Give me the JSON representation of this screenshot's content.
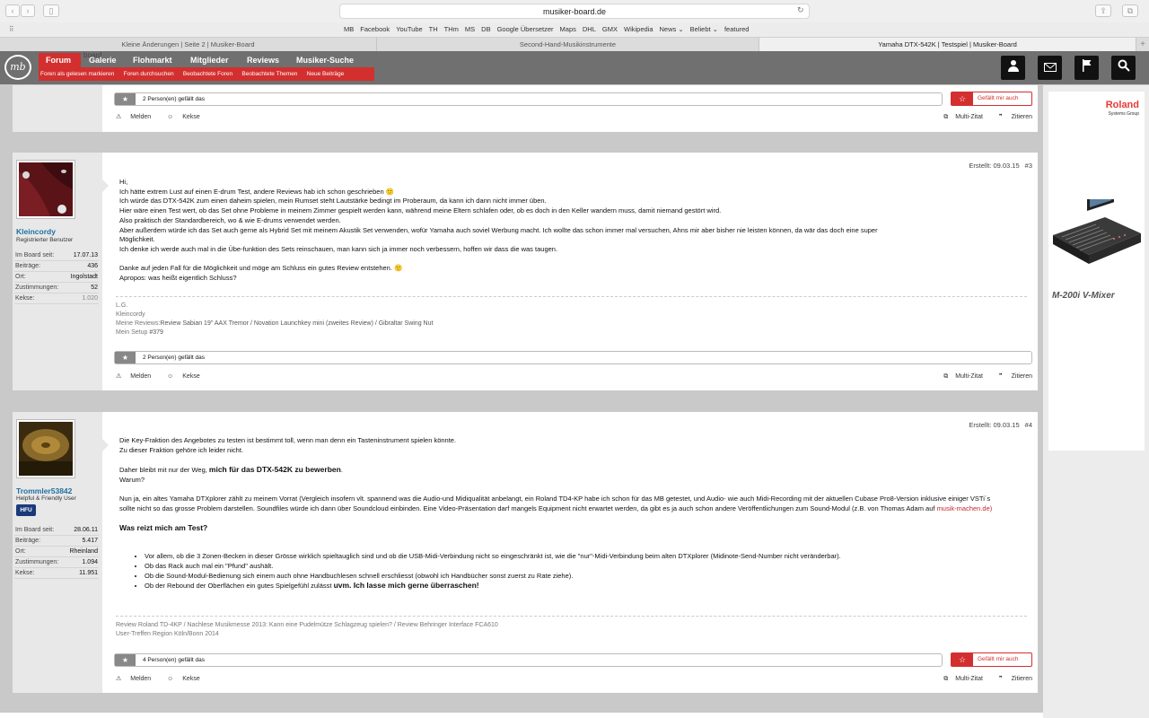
{
  "browser": {
    "url": "musiker-board.de",
    "bookmarks": [
      "MB",
      "Facebook",
      "YouTube",
      "TH",
      "THm",
      "MS",
      "DB",
      "Google Übersetzer",
      "Maps",
      "DHL",
      "GMX",
      "Wikipedia",
      "News ⌄",
      "Beliebt ⌄",
      "featured"
    ],
    "tabs": [
      {
        "label": "Kleine Änderungen | Seite 2 | Musiker-Board"
      },
      {
        "label": "Second-Hand-Musikinstrumente"
      },
      {
        "label": "Yamaha DTX-542K | Testspiel | Musiker-Board"
      }
    ]
  },
  "site": {
    "logo": "mb",
    "logo_sub": "board",
    "nav": [
      "Forum",
      "Galerie",
      "Flohmarkt",
      "Mitglieder",
      "Reviews",
      "Musiker-Suche"
    ],
    "subnav": [
      "Foren als gelesen markieren",
      "Foren durchsuchen",
      "Beobachtete Foren",
      "Beobachtete Themen",
      "Neue Beiträge"
    ]
  },
  "top_fragment": {
    "like_text": "2 Person(en) gefällt das",
    "like_button": "Gefällt mir auch",
    "report": "Melden",
    "cookies": "Kekse",
    "multiquote": "Multi-Zitat",
    "quote": "Zitieren"
  },
  "posts": [
    {
      "username": "Kleincordy",
      "usertitle": "Registrierter Benutzer",
      "stats": [
        {
          "k": "Im Board seit:",
          "v": "17.07.13"
        },
        {
          "k": "Beiträge:",
          "v": "436"
        },
        {
          "k": "Ort:",
          "v": "Ingolstadt"
        },
        {
          "k": "Zustimmungen:",
          "v": "52"
        },
        {
          "k": "Kekse:",
          "v": "1.020"
        }
      ],
      "created": "Erstellt: 09.03.15",
      "number": "#3",
      "lines": [
        "Hi,",
        "Ich hätte extrem Lust auf einen E-drum Test, andere Reviews hab ich schon geschrieben 🙂",
        "Ich würde das DTX-542K zum einen daheim spielen, mein Rumset steht Lautstärke bedingt im Proberaum, da kann ich dann nicht immer üben.",
        "Hier wäre einen Test wert, ob das Set ohne Probleme in meinem Zimmer gespielt werden kann, während meine Eltern schlafen oder, ob es doch in den Keller wandern muss, damit niemand gestört wird.",
        "Also praktisch der Standardbereich, wo & wie E-drums verwendet werden.",
        "Aber außerdem würde ich das Set auch gerne als Hybrid Set mit meinem Akustik Set verwenden, wofür Yamaha auch soviel Werbung macht. Ich wollte das schon immer mal versuchen, Ahns mir aber bisher nie leisten können, da wär das doch eine super",
        "Möglichkeit.",
        "Ich denke ich werde auch mal in die Übe-funktion des Sets reinschauen, man kann sich ja immer noch verbessern, hoffen wir dass die was taugen.",
        "",
        "Danke auf jeden Fall für die Möglichkeit und möge am Schluss ein gutes Review entstehen. 🙂",
        "Apropos: was heißt eigentlich Schluss?"
      ],
      "sig": {
        "l1": "L.G.",
        "l2": "Kleincordy",
        "l3_label": "Meine Reviews:",
        "l3_text": "Review Sabian 19\" AAX Tremor / Novation Launchkey mini (zweites Review) / Gibraltar Swing Nut",
        "l4_label": "Mein Setup",
        "l4_text": " #379"
      },
      "like_text": "2 Person(en) gefällt das",
      "report": "Melden",
      "cookies": "Kekse",
      "multiquote": "Multi-Zitat",
      "quote": "Zitieren"
    },
    {
      "username": "Trommler53842",
      "usertitle": "Helpful & Friendly User",
      "badge": "HFU",
      "stats": [
        {
          "k": "Im Board seit:",
          "v": "28.06.11"
        },
        {
          "k": "Beiträge:",
          "v": "5.417"
        },
        {
          "k": "Ort:",
          "v": "Rheinland"
        },
        {
          "k": "Zustimmungen:",
          "v": "1.094"
        },
        {
          "k": "Kekse:",
          "v": "11.951"
        }
      ],
      "created": "Erstellt: 09.03.15",
      "number": "#4",
      "p1": "Die Key-Fraktion des Angebotes zu testen ist bestimmt toll, wenn man denn ein Tasteninstrument spielen könnte.",
      "p2": "Zu dieser Fraktion gehöre ich leider nicht.",
      "p3a": "Daher bleibt mit nur der Weg, ",
      "p3b": "mich für das DTX-542K zu bewerben",
      "p3c": ".",
      "p4": "Warum?",
      "p5": "Nun ja, ein altes Yamaha DTXplorer zählt zu meinem Vorrat (Vergleich insofern vlt. spannend was die Audio-und Midiqualität anbelangt, ein Roland TD4-KP habe ich schon für das MB getestet, und Audio- wie auch Midi-Recording mit der aktuellen Cubase Pro8-Version inklusive einiger VSTi´s sollte nicht so das grosse Problem darstellen. Soundfiles würde ich dann über Soundcloud einbinden. Eine Video-Präsentation darf mangels Equipment nicht erwartet werden, da gibt es ja auch schon andere Veröffentlichungen zum Sound-Modul (z.B. von Thomas Adam auf ",
      "p5_link": "musik-machen.de)",
      "heading": "Was reizt mich am Test?",
      "bullets": [
        "Vor allem, ob die 3 Zonen-Becken in dieser Grösse wirklich spieltauglich sind und ob die USB-Midi-Verbindung nicht so eingeschränkt ist, wie die \"nur\"-Midi-Verbindung beim alten DTXplorer (Midinote-Send-Number nicht veränderbar).",
        "Ob das Rack auch mal ein \"Pfund\" aushält.",
        "Ob die Sound-Modul-Bedienung sich einem auch ohne Handbuchlesen schnell erschliesst (obwohl ich Handbücher sonst zuerst zu Rate ziehe)."
      ],
      "bullet4a": "Ob der Rebound der Oberflächen ein gutes Spielgefühl zulässt ",
      "bullet4b": "uvm. Ich lasse mich gerne überraschen!",
      "sig_l1": "Review Roland TD-4KP / Nachlese Musikmesse 2013: Kann eine Pudelmütze Schlagzeug spielen? / Review Behringer Interface FCA610",
      "sig_l2": "User-Treffen Region Köln/Bonn 2014",
      "like_text": "4 Person(en) gefällt das",
      "like_button": "Gefällt mir auch",
      "report": "Melden",
      "cookies": "Kekse",
      "multiquote": "Multi-Zitat",
      "quote": "Zitieren"
    }
  ],
  "ad": {
    "brand": "Roland",
    "brand_sub": "Systems Group",
    "model": "M-200i V-Mixer"
  }
}
